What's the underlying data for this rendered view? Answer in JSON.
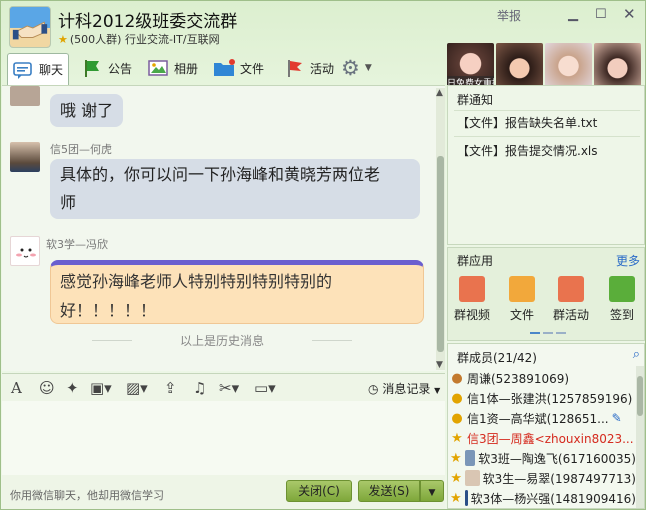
{
  "window": {
    "title": "计科2012级班委交流群",
    "subtitle": "(500人群) 行业交流-IT/互联网",
    "report": "举报"
  },
  "toolbar": {
    "chat": "聊天",
    "notice": "公告",
    "album": "相册",
    "file": "文件",
    "activity": "活动"
  },
  "avatars_strip": {
    "caption": "日免费女重播"
  },
  "messages": [
    {
      "sender": "",
      "text": "哦  谢了"
    },
    {
      "sender": "信5团—何虎",
      "line1": "具体的，你可以问一下孙海峰和黄晓芳两位老",
      "line2": "师"
    },
    {
      "sender": "软3学—冯欣",
      "line1": "感觉孙海峰老师人特别特别特别特别的",
      "line2": "好！！！！！"
    }
  ],
  "history_marker": "以上是历史消息",
  "input": {
    "history_button": "消息记录",
    "hint": "你用微信聊天，他却用微信学习",
    "close_button": "关闭(C)",
    "send_button": "发送(S)"
  },
  "notice_panel": {
    "title": "群通知",
    "items": [
      "【文件】报告缺失名单.txt",
      "【文件】报告提交情况.xls"
    ]
  },
  "apps_panel": {
    "title": "群应用",
    "more": "更多",
    "items": [
      "群视频",
      "文件",
      "群活动",
      "签到"
    ]
  },
  "members_panel": {
    "title": "群成员(21/42)",
    "members": [
      {
        "name": "周谦(523891069)",
        "red": false
      },
      {
        "name": "信1体—张建洪(1257859196)",
        "red": false
      },
      {
        "name": "信1资—高华斌(128651...",
        "red": false
      },
      {
        "name": "信3团—周鑫<zhouxin8023...",
        "red": true
      },
      {
        "name": "软3班—陶逸飞(617160035)",
        "red": false
      },
      {
        "name": "软3生—易翠(1987497713)",
        "red": false
      },
      {
        "name": "软3体—杨兴强(1481909416)",
        "red": false
      }
    ]
  },
  "colors": {
    "bubble": "#d6dde6",
    "special_bubble": "#fde2b9",
    "button": "#8fb64c",
    "highlight_member": "#d52a1e"
  }
}
